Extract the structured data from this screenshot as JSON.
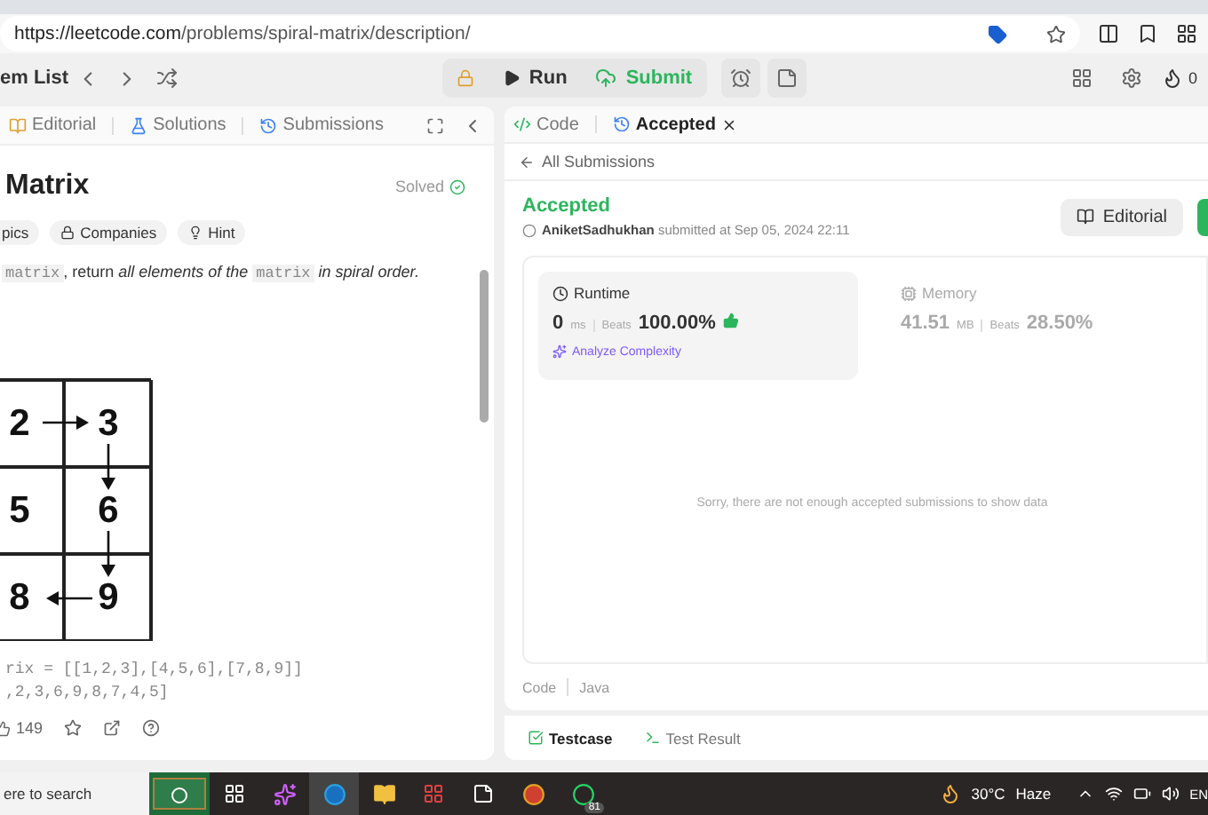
{
  "browser": {
    "url_host": "https://leetcode.com",
    "url_path": "/problems/spiral-matrix/description/"
  },
  "toolbar": {
    "problem_list": "em List",
    "run": "Run",
    "submit": "Submit",
    "streak": "0"
  },
  "left_tabs": [
    {
      "label": "Editorial",
      "selected": false
    },
    {
      "label": "Solutions",
      "selected": false
    },
    {
      "label": "Submissions",
      "selected": false
    }
  ],
  "problem": {
    "title": "Matrix",
    "status": "Solved",
    "tags": [
      {
        "label": "pics"
      },
      {
        "label": "Companies"
      },
      {
        "label": "Hint"
      }
    ],
    "description": [
      {
        "kind": "code",
        "text": "matrix"
      },
      {
        "kind": "plain",
        "text": ", return "
      },
      {
        "kind": "italic",
        "text": "all elements of the "
      },
      {
        "kind": "code",
        "text": "matrix"
      },
      {
        "kind": "italic",
        "text": " in spiral order."
      }
    ],
    "grid": [
      "2",
      "3",
      "5",
      "6",
      "8",
      "9"
    ],
    "example": [
      "rix = [[1,2,3],[4,5,6],[7,8,9]]",
      ",2,3,6,9,8,7,4,5]"
    ],
    "likes": "149"
  },
  "right_tabs": [
    {
      "label": "Code",
      "selected": false
    },
    {
      "label": "Accepted",
      "selected": true
    }
  ],
  "back": "All Submissions",
  "result": {
    "status": "Accepted",
    "user": "AniketSadhukhan",
    "submitted": "submitted at Sep 05, 2024 22:11",
    "editorial": "Editorial"
  },
  "metrics": [
    {
      "label": "Runtime",
      "value": "0",
      "unit": "ms",
      "beats_label": "Beats",
      "beats": "100.00%",
      "selected": true,
      "analyze": "Analyze Complexity"
    },
    {
      "label": "Memory",
      "value": "41.51",
      "unit": "MB",
      "beats_label": "Beats",
      "beats": "28.50%",
      "selected": false
    }
  ],
  "empty_message": "Sorry, there are not enough accepted submissions to show data",
  "code_info": [
    "Code",
    "Java"
  ],
  "bottom_tabs": [
    {
      "label": "Testcase",
      "selected": true
    },
    {
      "label": "Test Result",
      "selected": false
    }
  ],
  "taskbar": {
    "search": "ere to search",
    "temperature": "30°C",
    "weather": "Haze",
    "language": "EN",
    "badge": "81"
  }
}
